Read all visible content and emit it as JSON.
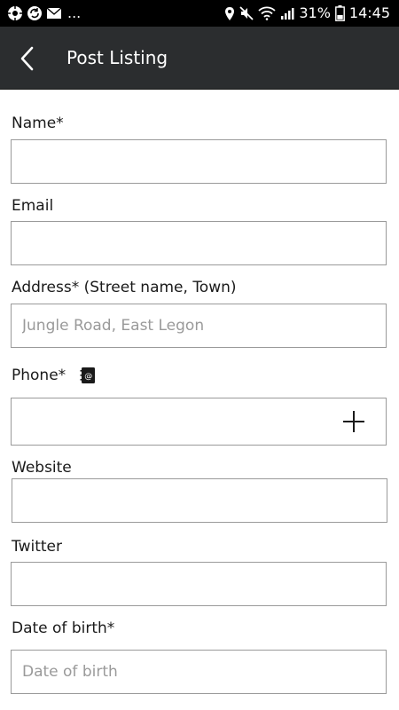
{
  "status_bar": {
    "battery_percent": "31%",
    "time": "14:45",
    "dots": "...",
    "icons": [
      "settings-notification-icon",
      "sync-icon",
      "mail-icon",
      "location-icon",
      "mute-icon",
      "wifi-icon",
      "signal-icon",
      "battery-icon"
    ]
  },
  "app_bar": {
    "title": "Post Listing",
    "back_icon": "chevron-left-icon",
    "background": "#2b2d2f"
  },
  "form": {
    "name": {
      "label": "Name*",
      "value": "",
      "placeholder": ""
    },
    "email": {
      "label": "Email",
      "value": "",
      "placeholder": ""
    },
    "address": {
      "label": "Address* (Street name, Town)",
      "value": "",
      "placeholder": "Jungle Road, East Legon"
    },
    "phone": {
      "label": "Phone*",
      "value": "",
      "placeholder": "",
      "contacts_icon": "contact-book-icon",
      "add_icon": "plus-icon"
    },
    "website": {
      "label": "Website",
      "value": "",
      "placeholder": ""
    },
    "twitter": {
      "label": "Twitter",
      "value": "",
      "placeholder": ""
    },
    "dob": {
      "label": "Date of birth*",
      "value": "",
      "placeholder": "Date of birth"
    }
  }
}
